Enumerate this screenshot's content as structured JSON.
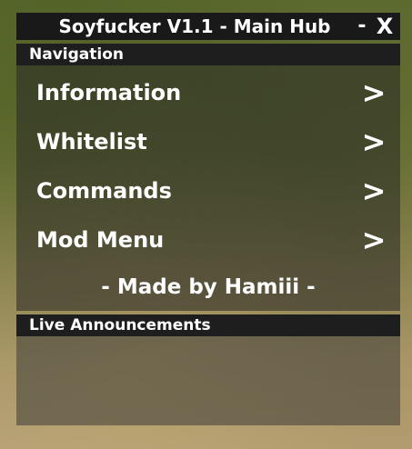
{
  "window": {
    "title": "Soyfucker V1.1 - Main Hub",
    "minimize_label": "-",
    "close_label": "X"
  },
  "navigation": {
    "header": "Navigation",
    "items": [
      {
        "label": "Information",
        "arrow": ">"
      },
      {
        "label": "Whitelist",
        "arrow": ">"
      },
      {
        "label": "Commands",
        "arrow": ">"
      },
      {
        "label": "Mod Menu",
        "arrow": ">"
      }
    ],
    "credit": "- Made by Hamiii -"
  },
  "live_announcements": {
    "header": "Live Announcements"
  },
  "colors": {
    "bar": "#191919",
    "text": "#ffffff"
  }
}
